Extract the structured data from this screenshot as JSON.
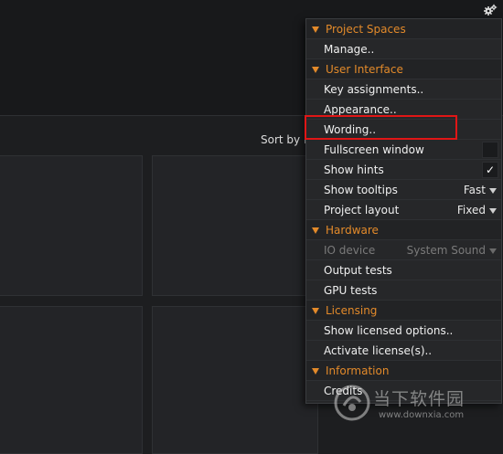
{
  "background": {
    "sort_label": "Sort by r"
  },
  "colors": {
    "section": "#e38a2a",
    "highlight": "#e01616",
    "menu_bg": "#262729"
  },
  "icons": {
    "gear": "gear-icon"
  },
  "menu": {
    "project_spaces": {
      "title": "Project Spaces",
      "manage": "Manage.."
    },
    "user_interface": {
      "title": "User Interface",
      "key_assignments": "Key assignments..",
      "appearance": "Appearance..",
      "wording": "Wording..",
      "fullscreen": "Fullscreen window",
      "show_hints": "Show hints",
      "show_hints_mark": "✓",
      "show_tooltips": "Show tooltips",
      "show_tooltips_value": "Fast",
      "project_layout": "Project layout",
      "project_layout_value": "Fixed"
    },
    "hardware": {
      "title": "Hardware",
      "io_device": "IO device",
      "io_device_value": "System Sound",
      "output_tests": "Output tests",
      "gpu_tests": "GPU tests"
    },
    "licensing": {
      "title": "Licensing",
      "show_licensed": "Show licensed options..",
      "activate_license": "Activate license(s).."
    },
    "information": {
      "title": "Information",
      "credits": "Credits"
    }
  },
  "watermark": {
    "line1": "当下软件园",
    "line2": "www.downxia.com"
  }
}
